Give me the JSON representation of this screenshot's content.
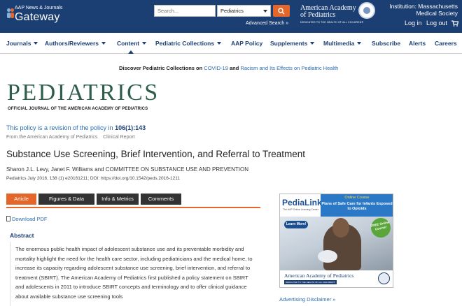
{
  "header": {
    "brand_small": "AAP News & Journals",
    "brand_big": "Gateway",
    "search_placeholder": "Search...",
    "search_scope": "Pediatrics",
    "advanced_search": "Advanced Search »",
    "aap_line1": "American Academy",
    "aap_line2": "of Pediatrics",
    "aap_tagline": "DEDICATED TO THE HEALTH OF ALL CHILDREN®",
    "institution": "Institution: Massachusetts Medical Society",
    "login": "Log in",
    "logout": "Log out",
    "colors": {
      "navy": "#1c3f73",
      "orange": "#e4662a"
    }
  },
  "nav": {
    "items": [
      {
        "label": "Journals",
        "dropdown": true
      },
      {
        "label": "Authors/Reviewers",
        "dropdown": true
      },
      {
        "label": "Content",
        "dropdown": true
      },
      {
        "label": "Pediatric Collections",
        "dropdown": true
      },
      {
        "label": "AAP Policy",
        "dropdown": false
      },
      {
        "label": "Supplements",
        "dropdown": true
      },
      {
        "label": "Multimedia",
        "dropdown": true
      },
      {
        "label": "Subscribe",
        "dropdown": false
      },
      {
        "label": "Alerts",
        "dropdown": false
      },
      {
        "label": "Careers",
        "dropdown": false
      }
    ]
  },
  "banner": {
    "prefix": "Discover Pediatric Collections on",
    "link1": "COVID-19",
    "and": "and",
    "link2": "Racism and Its Effects on Pediatric Health"
  },
  "journal": {
    "title": "PEDIATRICS",
    "subtitle": "OFFICIAL JOURNAL OF THE AMERICAN ACADEMY OF PEDIATRICS"
  },
  "article": {
    "revision_text": "This policy is a revision of the policy in",
    "revision_ref": "106(1):143",
    "from_line": "From the American Academy of Pediatrics    Clinical Report",
    "title": "Substance Use Screening, Brief Intervention, and Referral to Treatment",
    "authors": "Sharon J.L. Levy, Janet F. Williams and COMMITTEE ON SUBSTANCE USE AND PREVENTION",
    "citation": "Pediatrics July 2016, 138 (1) e20161211; DOI: https://doi.org/10.1542/peds.2016-1211",
    "tabs": [
      "Article",
      "Figures & Data",
      "Info & Metrics",
      "Comments"
    ],
    "download_pdf": "Download PDF",
    "abstract_heading": "Abstract",
    "abstract_text": "The enormous public health impact of adolescent substance use and its preventable morbidity and mortality highlight the need for the health care sector, including pediatricians and the medical home, to increase its capacity regarding adolescent substance use screening, brief intervention, and referral to treatment (SBIRT). The American Academy of Pediatrics first published a policy statement on SBIRT and adolescents in 2011 to introduce SBIRT concepts and terminology and to offer clinical guidance about available substance use screening tools"
  },
  "ad": {
    "brand": "PediaLink",
    "brand_sub": "The AAP Online Learning Center",
    "course": "Online Course",
    "plans": "Plans of Safe Care for Infants Exposed to Opioids",
    "learn_more": "Learn More!",
    "free_badge": "FREE Online Course!",
    "aap": "American Academy of Pediatrics",
    "aap_tag": "DEDICATED TO THE HEALTH OF ALL CHILDREN®",
    "disclaimer": "Advertising Disclaimer »"
  }
}
